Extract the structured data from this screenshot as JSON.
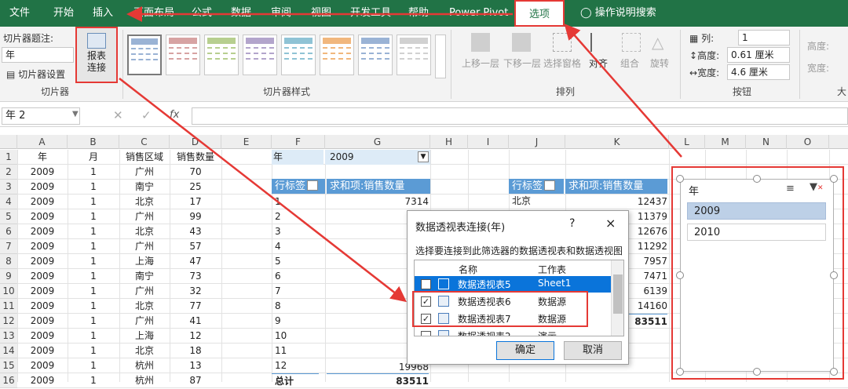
{
  "tabs": [
    "文件",
    "开始",
    "插入",
    "页面布局",
    "公式",
    "数据",
    "审阅",
    "视图",
    "开发工具",
    "帮助",
    "Power Pivot",
    "选项",
    "操作说明搜索"
  ],
  "ribbon": {
    "slicer_caption_label": "切片器题注:",
    "slicer_caption_value": "年",
    "slicer_settings": "切片器设置",
    "report_connect": "报表\n连接",
    "group_slicer": "切片器",
    "group_styles": "切片器样式",
    "arrange": {
      "bring_forward": "上移一层",
      "send_backward": "下移一层",
      "selection_pane": "选择窗格",
      "align": "对齐",
      "group": "组合",
      "rotate": "旋转"
    },
    "group_arrange": "排列",
    "columns_label": "列:",
    "columns_value": "1",
    "height_label": "高度:",
    "height_value": "0.61 厘米",
    "width_label": "宽度:",
    "width_value": "4.6 厘米",
    "group_buttons": "按钮",
    "size_height": "高度:",
    "size_width": "宽度:",
    "group_size_partial": "大"
  },
  "formula_bar": {
    "name_box": "年 2",
    "fx": "fx"
  },
  "columns": [
    "A",
    "B",
    "C",
    "D",
    "E",
    "F",
    "G",
    "H",
    "I",
    "J",
    "K",
    "L",
    "M",
    "N",
    "O"
  ],
  "rows": [
    "1",
    "2",
    "3",
    "4",
    "5",
    "6",
    "7",
    "8",
    "9",
    "10",
    "11",
    "12",
    "13",
    "14",
    "15",
    "16"
  ],
  "table": {
    "headers": [
      "年",
      "月",
      "销售区域",
      "销售数量"
    ],
    "data": [
      [
        "2009",
        "1",
        "广州",
        "70"
      ],
      [
        "2009",
        "1",
        "南宁",
        "25"
      ],
      [
        "2009",
        "1",
        "北京",
        "17"
      ],
      [
        "2009",
        "1",
        "广州",
        "99"
      ],
      [
        "2009",
        "1",
        "北京",
        "43"
      ],
      [
        "2009",
        "1",
        "广州",
        "57"
      ],
      [
        "2009",
        "1",
        "上海",
        "47"
      ],
      [
        "2009",
        "1",
        "南宁",
        "73"
      ],
      [
        "2009",
        "1",
        "广州",
        "32"
      ],
      [
        "2009",
        "1",
        "北京",
        "77"
      ],
      [
        "2009",
        "1",
        "广州",
        "41"
      ],
      [
        "2009",
        "1",
        "上海",
        "12"
      ],
      [
        "2009",
        "1",
        "北京",
        "18"
      ],
      [
        "2009",
        "1",
        "杭州",
        "13"
      ],
      [
        "2009",
        "1",
        "杭州",
        "87"
      ]
    ]
  },
  "pivot1": {
    "filter_label": "年",
    "filter_value": "2009",
    "row_label": "行标签",
    "sum_label": "求和项:销售数量",
    "rows": [
      "1",
      "2",
      "3",
      "4",
      "5",
      "6",
      "7",
      "8",
      "9",
      "10",
      "11",
      "12"
    ],
    "values": [
      "7314",
      "",
      "",
      "",
      "",
      "",
      "",
      "",
      "",
      "",
      "",
      ""
    ],
    "visible_row12_value": "19968",
    "total_label": "总计",
    "total_value": "83511"
  },
  "pivot2": {
    "row_label": "行标签",
    "sum_label": "求和项:销售数量",
    "first_row": "北京",
    "values": [
      "12437",
      "11379",
      "12676",
      "11292",
      "7957",
      "7471",
      "6139",
      "14160"
    ],
    "total_value": "83511"
  },
  "dialog": {
    "title": "数据透视表连接(年)",
    "help": "?",
    "close": "×",
    "prompt": "选择要连接到此筛选器的数据透视表和数据透视图",
    "col_name": "名称",
    "col_sheet": "工作表",
    "items": [
      {
        "name": "数据透视表5",
        "sheet": "Sheet1",
        "checked": false
      },
      {
        "name": "数据透视表6",
        "sheet": "数据源",
        "checked": true
      },
      {
        "name": "数据透视表7",
        "sheet": "数据源",
        "checked": true
      },
      {
        "name": "数据透视表2",
        "sheet": "演示",
        "checked": false
      }
    ],
    "ok": "确定",
    "cancel": "取消"
  },
  "slicer": {
    "title": "年",
    "items": [
      "2009",
      "2010"
    ]
  },
  "colors": {
    "excel_green": "#217346",
    "highlight_red": "#e53935",
    "pivot_header": "#5b9bd5",
    "slicer_selected": "#bdd0e7",
    "dialog_selected": "#0a74da"
  }
}
